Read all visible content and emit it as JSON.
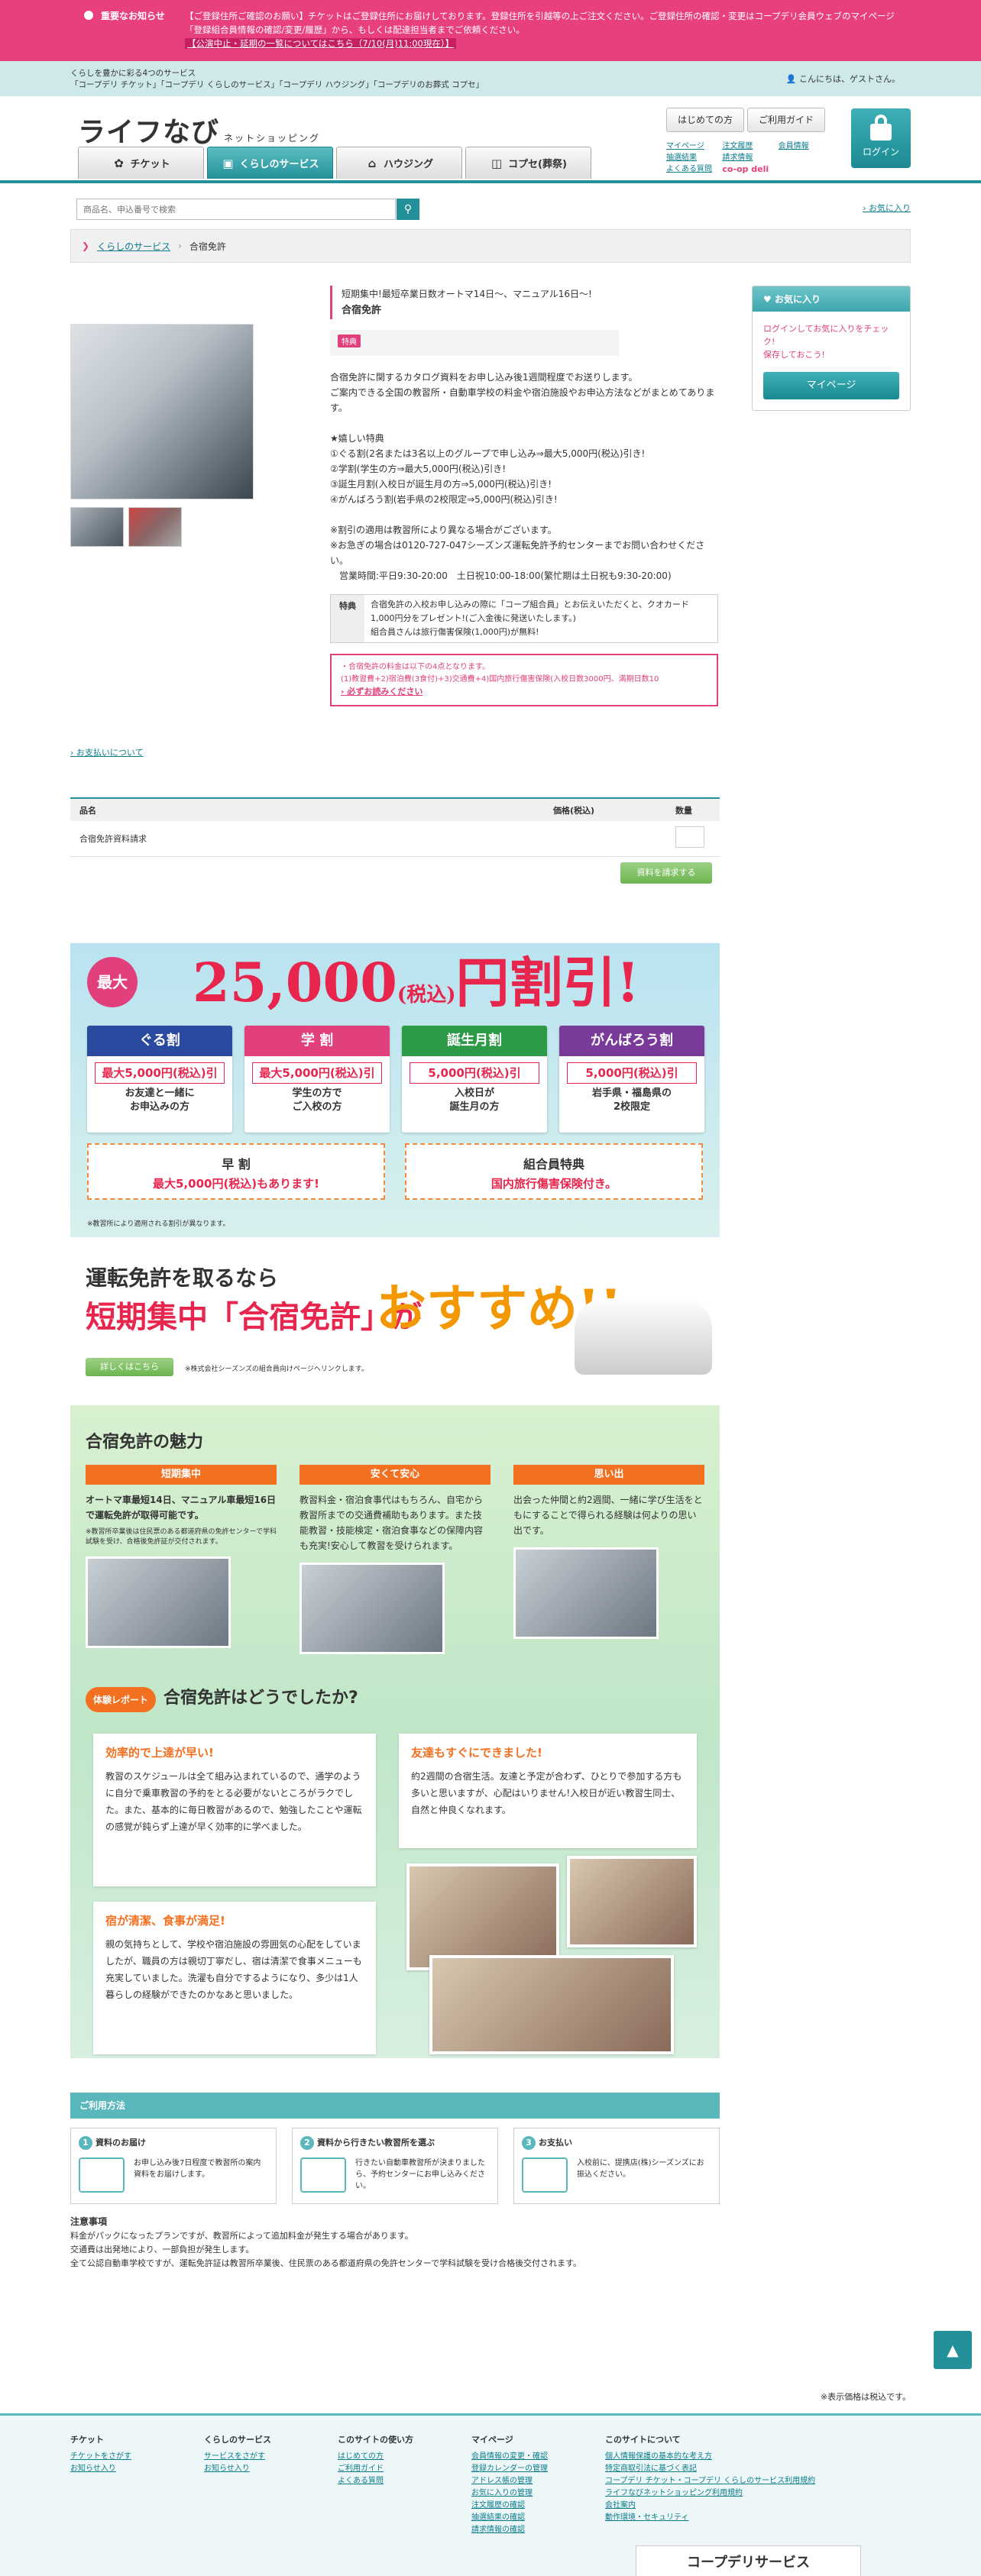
{
  "notice": {
    "label": "重要なお知らせ",
    "text": "【ご登録住所ご確認のお願い】チケットはご登録住所にお届けしております。登録住所を引越等の上ご注文ください。ご登録住所の確認・変更はコープデリ会員ウェブのマイページ「登録組合員情報の確認/変更/履歴」から、もしくは配達担当者までご依頼ください。",
    "link": "【公演中止・延期の一覧についてはこちら（7/10(月)11:00現在）】"
  },
  "topbar": {
    "line1": "くらしを豊かに彩る4つのサービス",
    "line2": "「コープデリ チケット」「コープデリ くらしのサービス」「コープデリ ハウジング」「コープデリのお葬式 コプセ」",
    "greeting": "こんにちは、ゲストさん。"
  },
  "header": {
    "logo": "ライフなび",
    "logo_sub": "ネットショッピング",
    "tabs": [
      {
        "label": "チケット",
        "icon": "✿"
      },
      {
        "label": "くらしのサービス",
        "icon": "▣"
      },
      {
        "label": "ハウジング",
        "icon": "⌂"
      },
      {
        "label": "コプセ(葬祭)",
        "icon": "◫"
      }
    ],
    "btn_first": "はじめての方",
    "btn_guide": "ご利用ガイド",
    "links": [
      "マイページ",
      "注文履歴",
      "会員情報",
      "抽選結果",
      "請求情報",
      "よくある質問"
    ],
    "coopdeli": "co-op deli",
    "login": "ログイン"
  },
  "search": {
    "placeholder": "商品名、申込番号で検索",
    "fav": "お気に入り"
  },
  "breadcrumb": {
    "home": "くらしのサービス",
    "current": "合宿免許"
  },
  "product": {
    "catch": "短期集中!最短卒業日数オートマ14日〜、マニュアル16日〜!",
    "name": "合宿免許",
    "tag": "特典",
    "desc": "合宿免許に関するカタログ資料をお申し込み後1週間程度でお送りします。\nご案内できる全国の教習所・自動車学校の料金や宿泊施設やお申込方法などがまとめてあります。\n\n★嬉しい特典\n①ぐる割(2名または3名以上のグループで申し込み⇒最大5,000円(税込)引き!\n②学割(学生の方⇒最大5,000円(税込)引き!\n③誕生月割(入校日が誕生月の方⇒5,000円(税込)引き!\n④がんばろう割(岩手県の2校限定⇒5,000円(税込)引き!\n\n※割引の適用は教習所により異なる場合がございます。\n※お急ぎの場合は0120-727-047シーズンズ運転免許予約センターまでお問い合わせください。\n　営業時間:平日9:30-20:00　土日祝10:00-18:00(繁忙期は土日祝も9:30-20:00)",
    "benefit_label": "特典",
    "benefit": "合宿免許の入校お申し込みの際に「コープ組合員」とお伝えいただくと、クオカード1,000円分をプレゼント!(ご入金後に発送いたします。)\n組合員さんは旅行傷害保険(1,000円)が無料!",
    "note1": "・合宿免許の料金は以下の4点となります。",
    "note2": "(1)教習費+2)宿泊費(3食付)+3)交通費+4)国内旅行傷害保険(入校日数3000円、満期日数10",
    "note_link": "必ずお読みください",
    "pay_link": "お支払いについて"
  },
  "favbox": {
    "title": "お気に入り",
    "text": "ログインしてお気に入りをチェック!\n保存しておこう!",
    "button": "マイページ"
  },
  "order": {
    "h_name": "品名",
    "h_price": "価格(税込)",
    "h_qty": "数量",
    "item": "合宿免許資料請求",
    "button": "資料を請求する"
  },
  "banner": {
    "max": "最大",
    "amount": "25,000",
    "tax": "(税込)",
    "unit": "円割引!",
    "cards": [
      {
        "title": "ぐる割",
        "color": "#2a4aa0",
        "value": "最大5,000円(税込)引",
        "d1": "お友達と一緒に",
        "d2": "お申込みの方"
      },
      {
        "title": "学 割",
        "color": "#e1407d",
        "value": "最大5,000円(税込)引",
        "d1": "学生の方で",
        "d2": "ご入校の方"
      },
      {
        "title": "誕生月割",
        "color": "#2d9a48",
        "value": "5,000円(税込)引",
        "d1": "入校日が",
        "d2": "誕生月の方"
      },
      {
        "title": "がんばろう割",
        "color": "#7a3a9a",
        "value": "5,000円(税込)引",
        "d1": "岩手県・福島県の",
        "d2": "2校限定"
      }
    ],
    "sub1_title": "早 割",
    "sub1_text": "最大5,000円(税込)もあります!",
    "sub2_title": "組合員特典",
    "sub2_text": "国内旅行傷害保険付き。",
    "foot": "※教習所により適用される割引が異なります。"
  },
  "ad2": {
    "t1": "運転免許を取るなら",
    "t2": "短期集中「合宿免許」が",
    "t3": "おすすめ!!",
    "button": "詳しくはこちら",
    "note": "※株式会社シーズンズの組合員向けページへリンクします。"
  },
  "charm": {
    "title": "合宿免許の魅力",
    "cols": [
      {
        "bar": "短期集中",
        "text": "オートマ車最短14日、マニュアル車最短16日で運転免許が取得可能です。",
        "note": "※教習所卒業後は住民票のある都道府県の免許センターで学科試験を受け、合格後免許証が交付されます。"
      },
      {
        "bar": "安くて安心",
        "text": "教習料金・宿泊食事代はもちろん、自宅から教習所までの交通費補助もあります。また技能教習・技能検定・宿泊食事などの保障内容も充実!安心して教習を受けられます。",
        "note": ""
      },
      {
        "bar": "思い出",
        "text": "出会った仲間と約2週間、一緒に学び生活をともにすることで得られる経験は何よりの思い出です。",
        "note": ""
      }
    ],
    "rep_badge": "体験レポート",
    "rep_title": "合宿免許はどうでしたか?",
    "reps": [
      {
        "head": "効率的で上達が早い!",
        "text": "教習のスケジュールは全て組み込まれているので、通学のように自分で乗車教習の予約をとる必要がないところがラクでした。また、基本的に毎日教習があるので、勉強したことや運転の感覚が鈍らず上達が早く効率的に学べました。"
      },
      {
        "head": "友達もすぐにできました!",
        "text": "約2週間の合宿生活。友達と予定が合わず、ひとりで参加する方も多いと思いますが、心配はいりません!入校日が近い教習生同士、自然と仲良くなれます。"
      },
      {
        "head": "宿が清潔、食事が満足!",
        "text": "親の気持ちとして、学校や宿泊施設の雰囲気の心配をしていましたが、職員の方は親切丁寧だし、宿は清潔で食事メニューも充実していました。洗濯も自分でするようになり、多少は1人暮らしの経験ができたのかなあと思いました。"
      }
    ]
  },
  "usage": {
    "title": "ご利用方法",
    "steps": [
      {
        "n": "1",
        "title": "資料のお届け",
        "text": "お申し込み後7日程度で教習所の案内資料をお届けします。"
      },
      {
        "n": "2",
        "title": "資料から行きたい教習所を選ぶ",
        "text": "行きたい自動車教習所が決まりましたら、予約センターにお申し込みください。"
      },
      {
        "n": "3",
        "title": "お支払い",
        "text": "入校前に、提携店(株)シーズンズにお振込ください。"
      }
    ]
  },
  "caution": {
    "title": "注意事項",
    "lines": [
      "料金がパックになったプランですが、教習所によって追加料金が発生する場合があります。",
      "交通費は出発地により、一部負担が発生します。",
      "全て公認自動車学校ですが、運転免許証は教習所卒業後、住民票のある都道府県の免許センターで学科試験を受け合格後交付されます。"
    ]
  },
  "pagetop": "▲",
  "taxnote": "※表示価格は税込です。",
  "footer": {
    "cols": [
      {
        "title": "チケット",
        "links": [
          "チケットをさがす",
          "お知らせ入り"
        ]
      },
      {
        "title": "くらしのサービス",
        "links": [
          "サービスをさがす",
          "お知らせ入り"
        ]
      },
      {
        "title": "このサイトの使い方",
        "links": [
          "はじめての方",
          "ご利用ガイド",
          "よくある質問"
        ]
      },
      {
        "title": "マイページ",
        "links": [
          "会員情報の変更・確認",
          "登録カレンダーの管理",
          "アドレス帳の管理",
          "お気に入りの管理",
          "注文履歴の確認",
          "抽選結果の確認",
          "請求情報の確認"
        ]
      },
      {
        "title": "このサイトについて",
        "links": [
          "個人情報保護の基本的な考え方",
          "特定商取引法に基づく表記",
          "コープデリ チケット・コープデリ くらしのサービス利用規約",
          "ライフなびネットショッピング利用規約",
          "会社案内",
          "動作環境・セキュリティ"
        ]
      }
    ],
    "brand": "コープデリサービス"
  }
}
